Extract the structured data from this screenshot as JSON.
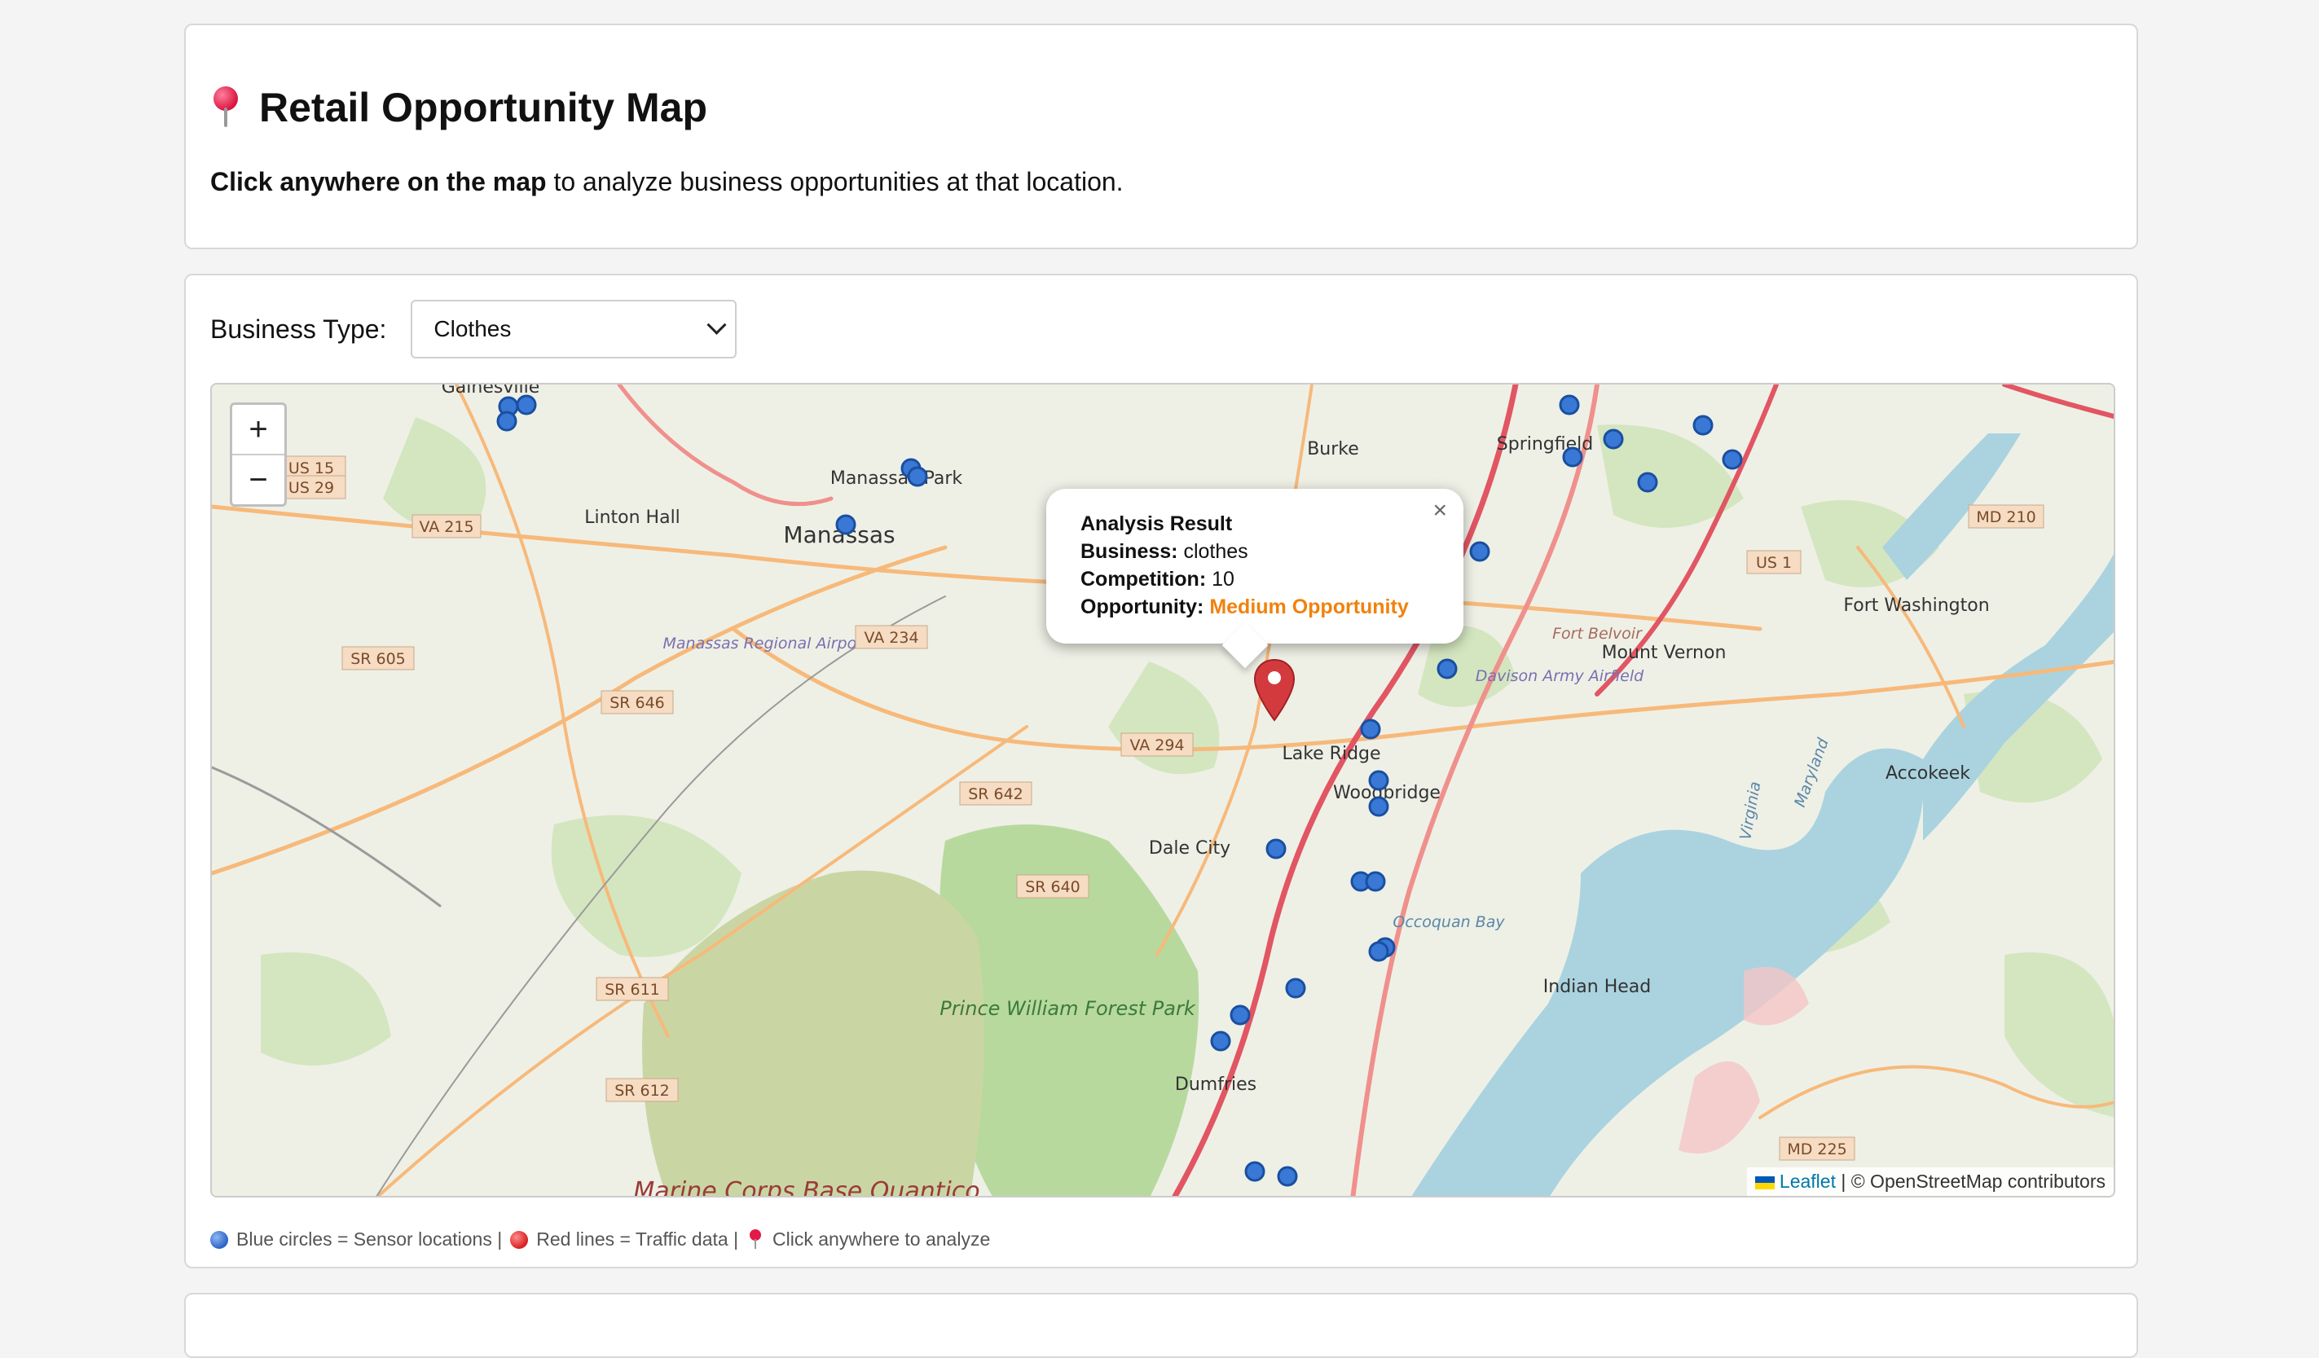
{
  "header": {
    "title": "Retail Opportunity Map",
    "subtitle_bold": "Click anywhere on the map",
    "subtitle_rest": " to analyze business opportunities at that location."
  },
  "controls": {
    "business_type_label": "Business Type:",
    "business_type_value": "Clothes"
  },
  "map": {
    "zoom_in": "+",
    "zoom_out": "−",
    "attribution_link": "Leaflet",
    "attribution_rest": " | © OpenStreetMap contributors",
    "labels": {
      "gainesville": "Gainesville",
      "manassas": "Manassas",
      "manassas_park": "Manassas Park",
      "linton_hall": "Linton Hall",
      "burke": "Burke",
      "springfield": "Springfield",
      "airport": "Manassas Regional Airport",
      "lake_ridge": "Lake Ridge",
      "woodbridge": "Woodbridge",
      "dale_city": "Dale City",
      "fort_belvoir": "Fort Belvoir",
      "mount_vernon": "Mount Vernon",
      "fort_washington": "Fort Washington",
      "davison": "Davison Army Airfield",
      "accokeek": "Accokeek",
      "occoquan_bay": "Occoquan Bay",
      "indian_head": "Indian Head",
      "prince_william": "Prince William Forest Park",
      "quantico": "Marine Corps Base Quantico",
      "dumfries": "Dumfries",
      "virginia": "Virginia",
      "maryland": "Maryland"
    },
    "shields": {
      "us15": "US 15",
      "us29": "US 29",
      "va215": "VA 215",
      "sr605": "SR 605",
      "sr646": "SR 646",
      "va234": "VA 234",
      "va294": "VA 294",
      "sr642": "SR 642",
      "sr640": "SR 640",
      "sr611": "SR 611",
      "sr612": "SR 612",
      "us1": "US 1",
      "md210": "MD 210",
      "md225": "MD 225"
    }
  },
  "popup": {
    "heading": "Analysis Result",
    "business_label": "Business:",
    "business_value": "clothes",
    "competition_label": "Competition:",
    "competition_value": "10",
    "opportunity_label": "Opportunity:",
    "opportunity_value": "Medium Opportunity",
    "close": "×"
  },
  "legend": {
    "sensor": "Blue circles = Sensor locations |",
    "traffic": "Red lines = Traffic data |",
    "click": "Click anywhere to analyze"
  }
}
